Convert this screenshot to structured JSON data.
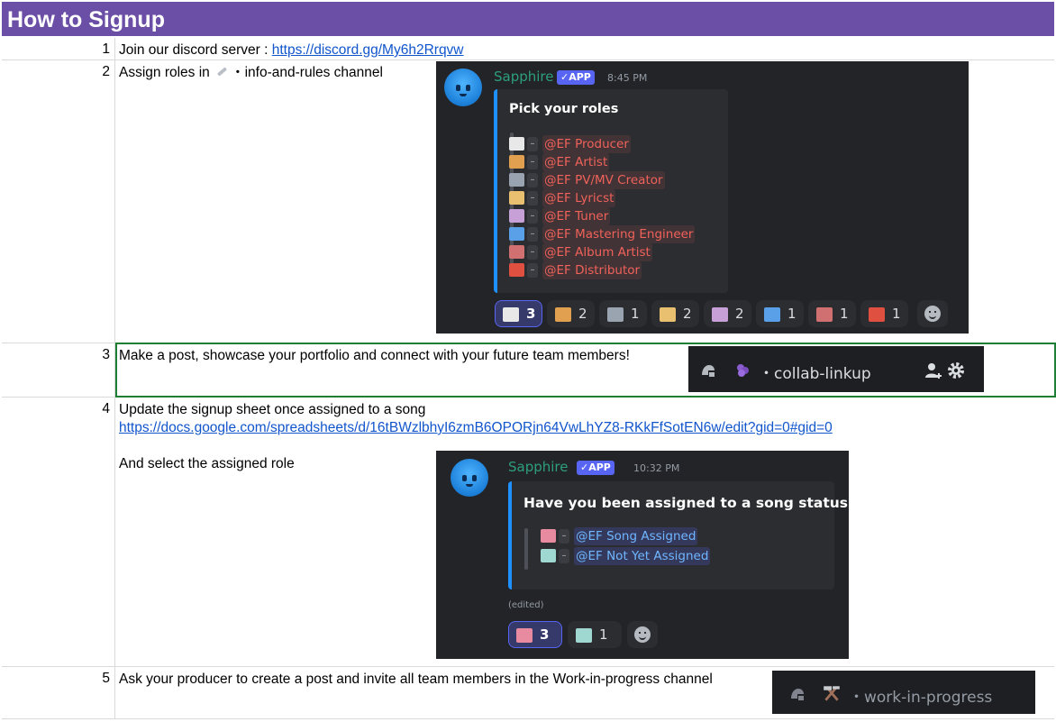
{
  "header": {
    "title": "How to Signup"
  },
  "rows": [
    {
      "num": "1",
      "text": "Join our discord server : ",
      "link": "https://discord.gg/My6h2Rrqvw"
    },
    {
      "num": "2",
      "text_before": "Assign roles in ",
      "text_after": "・info-and-rules channel",
      "emoji": "ruler-icon"
    },
    {
      "num": "3",
      "text": "Make a post, showcase your portfolio and connect with your future team members!"
    },
    {
      "num": "4",
      "text": "Update the signup sheet once assigned to a song",
      "link": "https://docs.google.com/spreadsheets/d/16tBWzlbhyI6zmB6OPORjn64VwLhYZ8-RKkFfSotEN6w/edit?gid=0#gid=0",
      "text2": "And select the assigned role"
    },
    {
      "num": "5",
      "text": "Ask your producer to create a post and invite all team members in the Work-in-progress channel"
    }
  ],
  "roles_card": {
    "bot_name": "Sapphire",
    "badge": "✓APP",
    "time": "8:45 PM",
    "embed_title": "Pick your roles",
    "roles": [
      {
        "icon": "piano-icon",
        "color": "#e8e8e8",
        "label": "@EF Producer"
      },
      {
        "icon": "palette-icon",
        "color": "#e0a050",
        "label": "@EF Artist"
      },
      {
        "icon": "film-icon",
        "color": "#9aa3b0",
        "label": "@EF PV/MV Creator"
      },
      {
        "icon": "scroll-icon",
        "color": "#e8c070",
        "label": "@EF Lyricst"
      },
      {
        "icon": "vocaloid-icon",
        "color": "#c8a0d8",
        "label": "@EF Tuner"
      },
      {
        "icon": "music-note-icon",
        "color": "#5aa0e8",
        "label": "@EF Mastering Engineer"
      },
      {
        "icon": "picture-icon",
        "color": "#d07070",
        "label": "@EF Album Artist"
      },
      {
        "icon": "truck-icon",
        "color": "#e05040",
        "label": "@EF Distributor"
      }
    ],
    "reactions": [
      {
        "icon": "piano-icon",
        "color": "#e8e8e8",
        "count": "3",
        "active": true
      },
      {
        "icon": "palette-icon",
        "color": "#e0a050",
        "count": "2",
        "active": false
      },
      {
        "icon": "film-icon",
        "color": "#9aa3b0",
        "count": "1",
        "active": false
      },
      {
        "icon": "scroll-icon",
        "color": "#e8c070",
        "count": "2",
        "active": false
      },
      {
        "icon": "vocaloid-icon",
        "color": "#c8a0d8",
        "count": "2",
        "active": false
      },
      {
        "icon": "music-note-icon",
        "color": "#5aa0e8",
        "count": "1",
        "active": false
      },
      {
        "icon": "picture-icon",
        "color": "#d07070",
        "count": "1",
        "active": false
      },
      {
        "icon": "truck-icon",
        "color": "#e05040",
        "count": "1",
        "active": false
      }
    ]
  },
  "collab_chip": {
    "label": "・collab-linkup"
  },
  "status_card": {
    "bot_name": "Sapphire",
    "badge": "✓APP",
    "time": "10:32 PM",
    "embed_title": "Have you been assigned to a song status",
    "roles": [
      {
        "icon": "assigned-icon",
        "color": "#e88aa0",
        "label": "@EF Song Assigned"
      },
      {
        "icon": "not-assigned-icon",
        "color": "#9fd8d0",
        "label": "@EF Not Yet Assigned"
      }
    ],
    "edited": "(edited)",
    "reactions": [
      {
        "icon": "assigned-icon",
        "color": "#e88aa0",
        "count": "3",
        "active": true
      },
      {
        "icon": "not-assigned-icon",
        "color": "#9fd8d0",
        "count": "1",
        "active": false
      }
    ]
  },
  "wip_chip": {
    "label": "・work-in-progress"
  }
}
